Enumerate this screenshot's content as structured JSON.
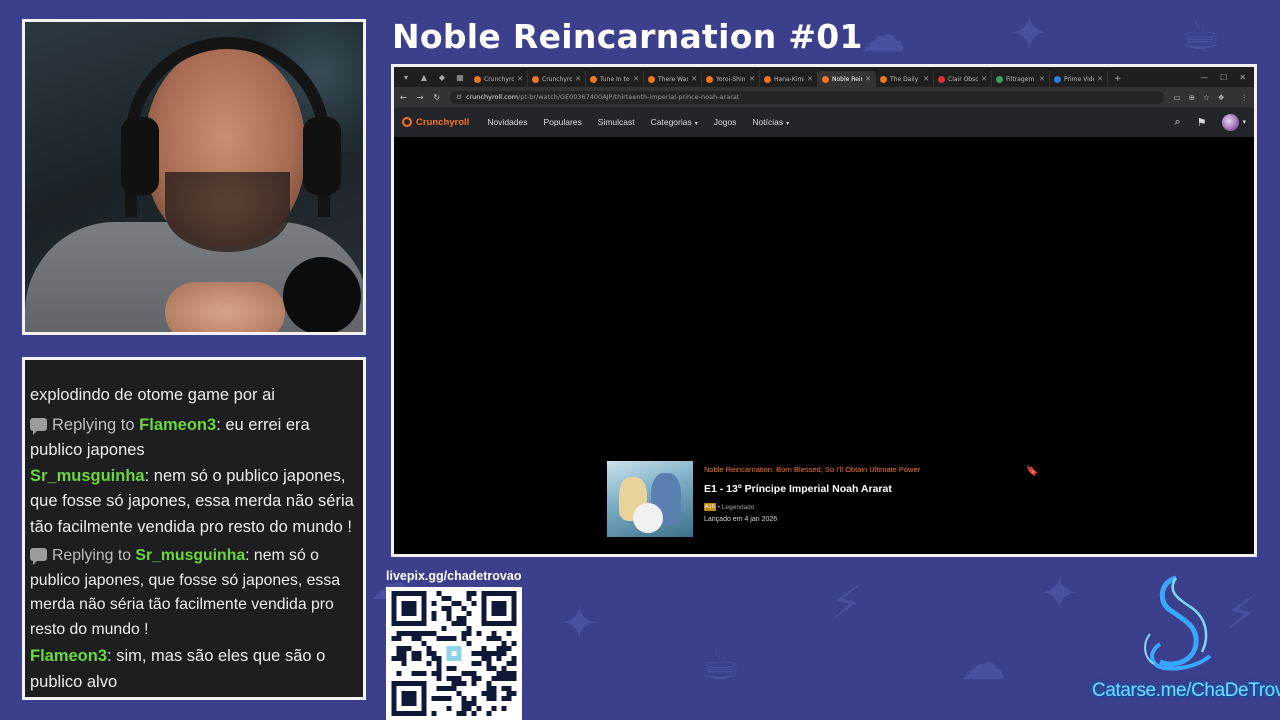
{
  "stream": {
    "title": "Noble Reincarnation #01",
    "livepix_label": "livepix.gg/chadetrovao",
    "catarse_link": "Catarse.me/ChaDeTrovao"
  },
  "chat": {
    "messages": [
      {
        "type": "continued",
        "text": "explodindo de otome game por ai"
      },
      {
        "type": "reply",
        "reply_prefix": "Replying to",
        "reply_user": "Flameon3",
        "text": ": eu errei era publico japones"
      },
      {
        "type": "message",
        "user": "Sr_musguinha",
        "text": ": nem só o publico japones, que fosse só japones, essa merda não séria tão facilmente vendida pro resto do mundo !"
      },
      {
        "type": "reply",
        "reply_prefix": "Replying to",
        "reply_user": "Sr_musguinha",
        "text": ": nem só o publico japones, que fosse só japones, essa merda não séria tão facilmente vendida pro resto do mundo !"
      },
      {
        "type": "message",
        "user": "Flameon3",
        "text": ": sim, mas são eles que são o publico alvo"
      }
    ]
  },
  "browser": {
    "tabs": [
      {
        "label": "Crunchyroll",
        "color": "#f47521"
      },
      {
        "label": "Crunchyroll",
        "color": "#f47521"
      },
      {
        "label": "Tune In to",
        "color": "#f47521"
      },
      {
        "label": "There Was",
        "color": "#f47521"
      },
      {
        "label": "Yoroi-Shin",
        "color": "#f47521"
      },
      {
        "label": "Hana-Kimi",
        "color": "#f47521"
      },
      {
        "label": "Noble Rein",
        "color": "#f47521",
        "active": true
      },
      {
        "label": "The Daily",
        "color": "#f47521"
      },
      {
        "label": "Clair Obsc",
        "color": "#e03030"
      },
      {
        "label": "Filtragem",
        "color": "#3aa55a"
      },
      {
        "label": "Prime Vide",
        "color": "#2d7be0"
      }
    ],
    "url_domain": "crunchyroll.com",
    "url_path": "/pt-br/watch/GE00367400AJP/thirteenth-imperial-prince-noah-ararat"
  },
  "crunchyroll": {
    "logo": "Crunchyroll",
    "nav": [
      "Novidades",
      "Populares",
      "Simulcast",
      "Categorias",
      "Jogos",
      "Notícias"
    ],
    "nav_dropdowns": [
      false,
      false,
      false,
      true,
      false,
      true
    ]
  },
  "episode": {
    "series": "Noble Reincarnation: Born Blessed, So I'll Obtain Ultimate Power",
    "title": "E1 - 13º Príncipe Imperial Noah Ararat",
    "rating": "A16",
    "audio": "• Legendado",
    "date": "Lançado em 4 jan 2026"
  },
  "colors": {
    "background": "#3b3f8c",
    "crunchyroll_orange": "#f47521",
    "chat_username": "#6bd83f",
    "catarse_text": "#7fd9ff"
  }
}
